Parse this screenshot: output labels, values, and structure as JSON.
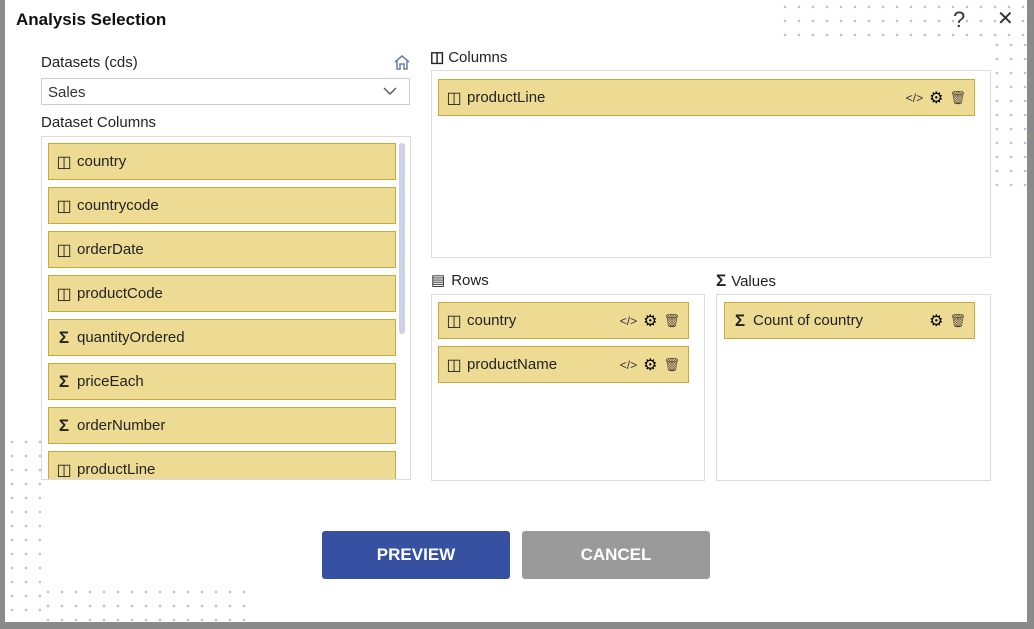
{
  "dialog": {
    "title": "Analysis Selection",
    "help": "?",
    "close": "✕"
  },
  "datasets": {
    "label": "Datasets (cds)",
    "selected": "Sales",
    "columns_label": "Dataset Columns",
    "columns": [
      {
        "name": "country",
        "type": "dimension"
      },
      {
        "name": "countrycode",
        "type": "dimension"
      },
      {
        "name": "orderDate",
        "type": "dimension"
      },
      {
        "name": "productCode",
        "type": "dimension"
      },
      {
        "name": "quantityOrdered",
        "type": "measure"
      },
      {
        "name": "priceEach",
        "type": "measure"
      },
      {
        "name": "orderNumber",
        "type": "measure"
      },
      {
        "name": "productLine",
        "type": "dimension"
      }
    ]
  },
  "columns": {
    "label": "Columns",
    "items": [
      "productLine"
    ]
  },
  "rows": {
    "label": "Rows",
    "items": [
      "country",
      "productName"
    ]
  },
  "values": {
    "label": "Values",
    "items": [
      "Count of country"
    ]
  },
  "buttons": {
    "preview": "PREVIEW",
    "cancel": "CANCEL"
  },
  "colors": {
    "item_bg": "#eddb94",
    "item_border": "#c8a93c",
    "preview": "#3650a2",
    "cancel": "#9a9a9a"
  }
}
